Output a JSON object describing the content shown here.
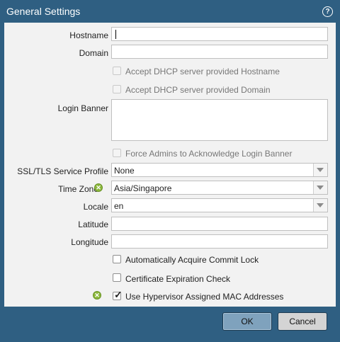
{
  "dialog": {
    "title": "General Settings",
    "help_icon": "help-icon"
  },
  "fields": {
    "hostname_label": "Hostname",
    "hostname_value": "",
    "domain_label": "Domain",
    "domain_value": "",
    "accept_dhcp_hostname_label": "Accept DHCP server provided Hostname",
    "accept_dhcp_domain_label": "Accept DHCP server provided Domain",
    "login_banner_label": "Login Banner",
    "login_banner_value": "",
    "force_ack_label": "Force Admins to Acknowledge Login Banner",
    "ssl_profile_label": "SSL/TLS Service Profile",
    "ssl_profile_value": "None",
    "timezone_label": "Time Zone",
    "timezone_value": "Asia/Singapore",
    "locale_label": "Locale",
    "locale_value": "en",
    "latitude_label": "Latitude",
    "latitude_value": "",
    "longitude_label": "Longitude",
    "longitude_value": "",
    "auto_commit_lock_label": "Automatically Acquire Commit Lock",
    "auto_commit_lock_checked": false,
    "cert_expiration_label": "Certificate Expiration Check",
    "cert_expiration_checked": false,
    "hypervisor_mac_label": "Use Hypervisor Assigned MAC Addresses",
    "hypervisor_mac_checked": true
  },
  "buttons": {
    "ok_label": "OK",
    "cancel_label": "Cancel"
  },
  "colors": {
    "titlebar": "#2f5f82",
    "panel": "#f2f2f2",
    "ok_button": "#7fa2bd",
    "status_green": "#8cb83c"
  }
}
